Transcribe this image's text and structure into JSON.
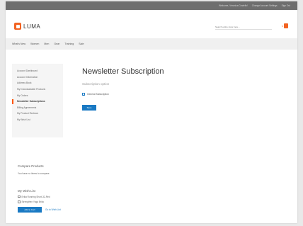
{
  "topbar": {
    "links": [
      "Welcome, Veronica Costello!",
      "Change Account Settings",
      "Sign Out"
    ]
  },
  "header": {
    "logo_text": "LUMA",
    "search_placeholder": "Search entire store here...",
    "cart_count": "1"
  },
  "nav": {
    "items": [
      "What's New",
      "Women",
      "Men",
      "Gear",
      "Training",
      "Sale"
    ]
  },
  "sidebar": {
    "items": [
      "Account Dashboard",
      "Account Information",
      "Address Book",
      "My Downloadable Products",
      "My Orders",
      "Newsletter Subscriptions",
      "Billing Agreements",
      "My Product Reviews",
      "My Wish List"
    ],
    "active_index": 5
  },
  "main": {
    "title": "Newsletter Subscription",
    "subheading": "Subscription option",
    "checkbox_label": "General Subscription",
    "checkbox_checked": true,
    "save_label": "Save"
  },
  "compare": {
    "title": "Compare Products",
    "empty_text": "You have no items to compare."
  },
  "mywish": {
    "title": "My Wish List",
    "items": [
      "Erika Running Short-32-Red",
      "Strengthen Yoga Brick"
    ],
    "add_to_cart_label": "Add to Cart",
    "view_all_label": "Go to Wish List"
  },
  "colors": {
    "accent": "#1979c3",
    "brand": "#f26322",
    "active_marker": "#ff5501",
    "topbar": "#6e6e6e"
  }
}
